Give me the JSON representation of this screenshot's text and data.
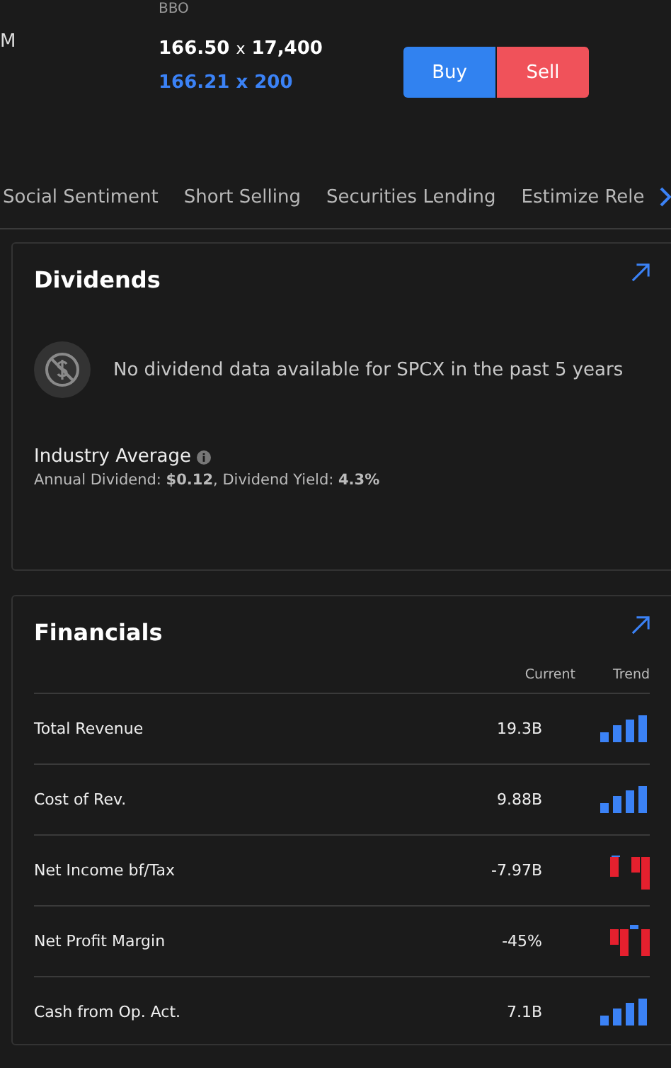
{
  "quote": {
    "left_label": "M",
    "bbo_label": "BBO",
    "ask": {
      "price": "166.50",
      "x": "x",
      "size": "17,400"
    },
    "bid": "166.21 x 200"
  },
  "actions": [
    {
      "label": "Buy",
      "kind": "buy"
    },
    {
      "label": "Sell",
      "kind": "sell"
    }
  ],
  "tabs": [
    {
      "label": "Social Sentiment"
    },
    {
      "label": "Short Selling"
    },
    {
      "label": "Securities Lending"
    },
    {
      "label": "Estimize Rele"
    }
  ],
  "dividends": {
    "title": "Dividends",
    "empty_message": "No dividend data available for SPCX in the past 5 years",
    "industry_title": "Industry Average",
    "industry_line": "Annual Dividend: **$0.12**, Dividend Yield: **4.3%**"
  },
  "financials": {
    "title": "Financials",
    "columns": [
      "Current",
      "Trend"
    ],
    "rows": [
      {
        "label": "Total Revenue",
        "value": "19.3B",
        "kind": "rising"
      },
      {
        "label": "Cost of Rev.",
        "value": "9.88B",
        "kind": "rising"
      },
      {
        "label": "Net Income bf/Tax",
        "value": "-7.97B",
        "kind": "negative"
      },
      {
        "label": "Net Profit Margin",
        "value": "-45%",
        "kind": "mixed"
      },
      {
        "label": "Cash from Op. Act.",
        "value": "7.1B",
        "kind": "rising"
      }
    ]
  }
}
